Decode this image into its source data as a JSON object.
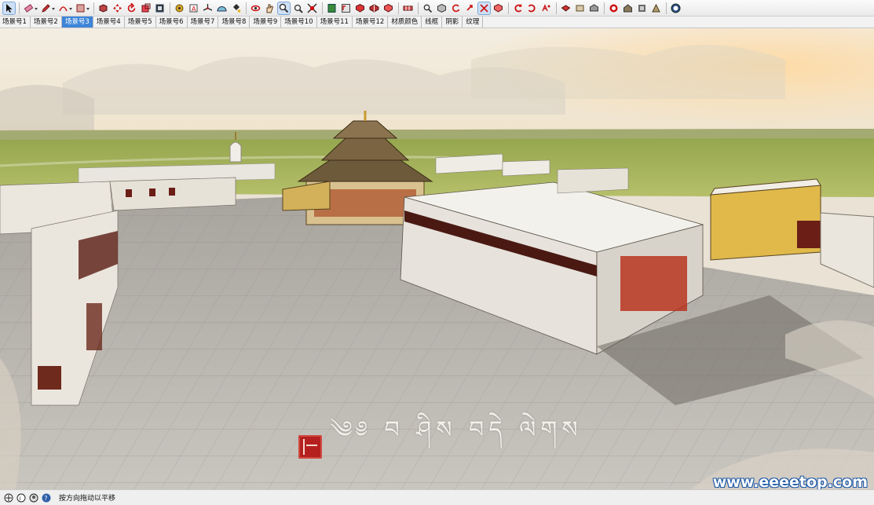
{
  "toolbar": {
    "icons": [
      "select-icon",
      "eraser-icon",
      "pencil-icon",
      "arc-icon",
      "rectangle-icon",
      "push-pull-icon",
      "move-icon",
      "rotate-icon",
      "scale-icon",
      "offset-icon",
      "tape-measure-icon",
      "text-icon",
      "axes-icon",
      "protractor-icon",
      "paint-bucket-icon",
      "orbit-icon",
      "pan-icon",
      "zoom-icon",
      "zoom-window-icon",
      "zoom-extents-icon",
      "previous-view-icon",
      "component-icon",
      "group-icon",
      "section-plane-icon",
      "walk-icon",
      "look-around-icon",
      "position-camera-icon",
      "iso-view-icon",
      "top-view-icon",
      "front-view-icon",
      "right-view-icon",
      "back-view-icon",
      "left-view-icon",
      "xray-icon",
      "wireframe-icon",
      "hidden-line-icon",
      "shaded-icon",
      "textured-icon",
      "monochrome-icon",
      "warehouse-icon",
      "extension-icon",
      "geo-location-icon",
      "help-icon"
    ]
  },
  "scene_tabs": [
    {
      "label": "场景号1",
      "active": false
    },
    {
      "label": "场景号2",
      "active": false
    },
    {
      "label": "场景号3",
      "active": true
    },
    {
      "label": "场景号4",
      "active": false
    },
    {
      "label": "场景号5",
      "active": false
    },
    {
      "label": "场景号6",
      "active": false
    },
    {
      "label": "场景号7",
      "active": false
    },
    {
      "label": "场景号8",
      "active": false
    },
    {
      "label": "场景号9",
      "active": false
    },
    {
      "label": "场景号10",
      "active": false
    },
    {
      "label": "场景号11",
      "active": false
    },
    {
      "label": "场景号12",
      "active": false
    },
    {
      "label": "材质颜色",
      "active": false
    },
    {
      "label": "线框",
      "active": false
    },
    {
      "label": "阴影",
      "active": false
    },
    {
      "label": "纹理",
      "active": false
    }
  ],
  "viewport": {
    "caption": "༄༅ བ ཤིས བདེ ལེགས",
    "watermark": "www.eeeetop.com"
  },
  "statusbar": {
    "message": "按方向拖动以平移",
    "icons": [
      "geo-location-status-icon",
      "credits-icon",
      "user-icon",
      "help-icon"
    ]
  },
  "colors": {
    "tab_active": "#3d85d8",
    "watermark_outline": "#1f5aa8",
    "seal": "#b5201e"
  }
}
